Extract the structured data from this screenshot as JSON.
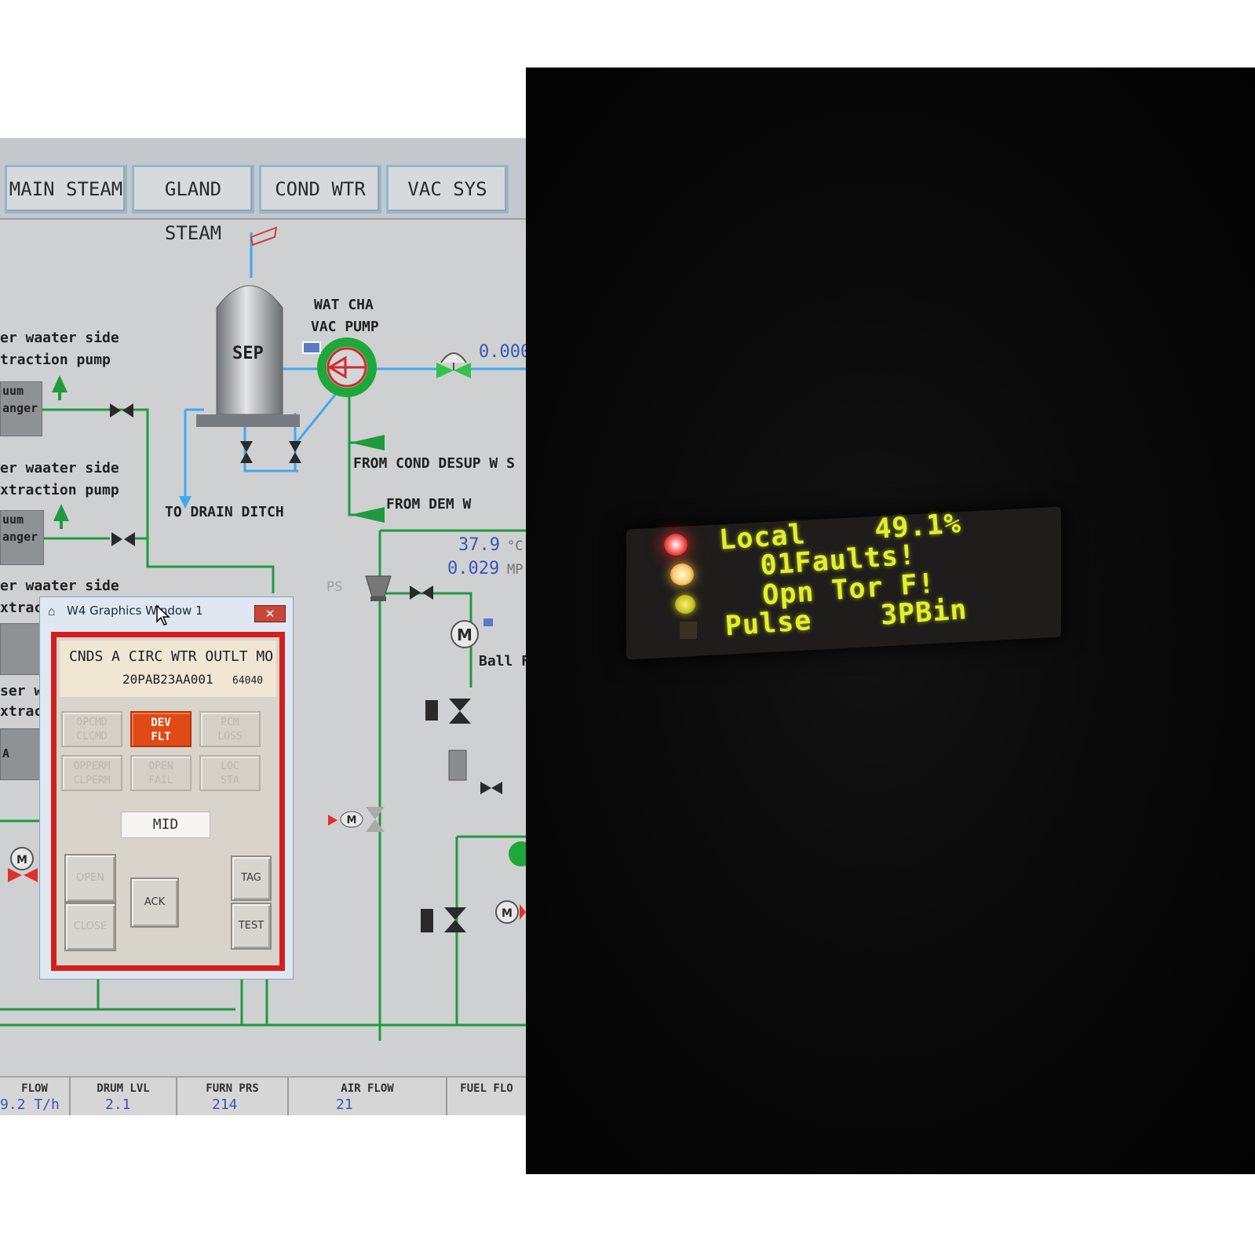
{
  "tabs": [
    "MAIN STEAM",
    "GLAND STEAM",
    "COND WTR",
    "VAC SYS"
  ],
  "diagram": {
    "label_side_1": "er waater side",
    "label_pump_1": "traction pump",
    "box_1_line1": "uum",
    "box_1_line2": "anger",
    "label_side_2": "er waater side",
    "label_pump_2": "xtraction pump",
    "box_2_line1": "uum",
    "box_2_line2": "anger",
    "label_side_3": "er waater side",
    "label_pump_3": "xtrac",
    "label_side_4": "ser w",
    "label_pump_4": "xtrac",
    "box_3": "A",
    "separator": "SEP",
    "pump_label_1": "WAT CHA",
    "pump_label_2": "VAC PUMP",
    "flow_value": "0.000",
    "from_cond_desup": "FROM COND DESUP W S",
    "from_dem": "FROM DEM W",
    "to_drain": "TO DRAIN DITCH",
    "temp_value": "37.9",
    "temp_unit": "°C",
    "press_value": "0.029",
    "press_unit": "MP",
    "ps_label": "PS",
    "ball_label": "Ball F",
    "motor_letter": "M"
  },
  "footer": [
    {
      "label": "FLOW",
      "value": "9.2 T/h"
    },
    {
      "label": "DRUM LVL",
      "value": "2.1"
    },
    {
      "label": "FURN PRS",
      "value": "214"
    },
    {
      "label": "AIR FLOW",
      "value": "21"
    },
    {
      "label": "FUEL FLO",
      "value": ""
    }
  ],
  "popup": {
    "title": "W4 Graphics Window 1",
    "close_glyph": "✕",
    "desc": "CNDS  A CIRC WTR OUTLT MO",
    "tag": "20PAB23AA001",
    "code": "64040",
    "status": [
      {
        "line1": "OPCMD",
        "line2": "CLCMD",
        "active": false
      },
      {
        "line1": "DEV",
        "line2": "FLT",
        "active": true
      },
      {
        "line1": "PCM",
        "line2": "LOSS",
        "active": false
      },
      {
        "line1": "OPPERM",
        "line2": "CLPERM",
        "active": false
      },
      {
        "line1": "OPEN",
        "line2": "FAIL",
        "active": false
      },
      {
        "line1": "LOC",
        "line2": "STA",
        "active": false
      }
    ],
    "position": "MID",
    "btn_open": "OPEN",
    "btn_close": "CLOSE",
    "btn_ack": "ACK",
    "btn_tag": "TAG",
    "btn_test": "TEST"
  },
  "lcd": {
    "line1": "Local    49.1%",
    "line2": "01Faults!",
    "line3": "Opn Tor F!",
    "line4": "Pulse    3PBin"
  },
  "colors": {
    "pipe_green": "#1f9a3c",
    "pipe_blue": "#3fa9f0",
    "alarm_orange": "#e04a16",
    "frame_red": "#d21e1e",
    "lcd_text": "#e2ef2c"
  }
}
